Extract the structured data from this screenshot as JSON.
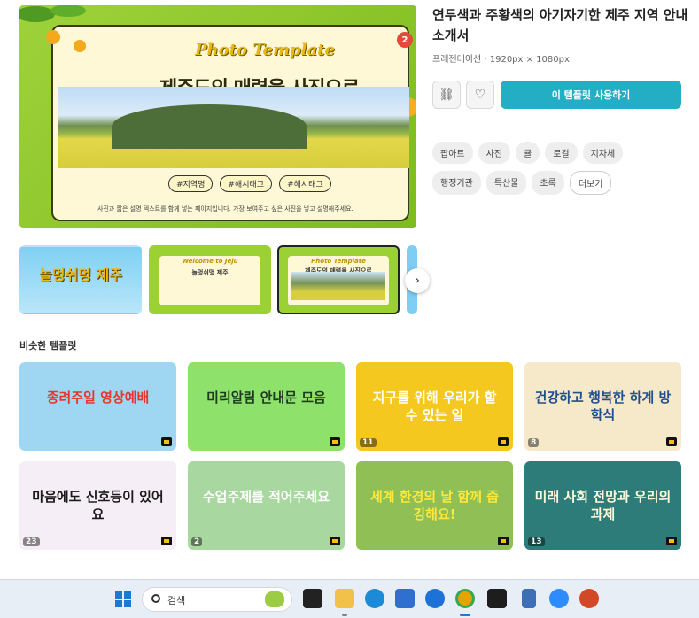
{
  "preview": {
    "script_title": "Photo Template",
    "title": "제주도의 매력을 사진으로",
    "badge": "2",
    "tags": [
      "#지역명",
      "#해시태그",
      "#해시태그"
    ],
    "caption": "사진과 짧은 설명 텍스트를 함께 넣는 페이지입니다. 가장 보여주고 싶은 사진을 넣고 설명해주세요."
  },
  "thumbnails": {
    "t1": "놀멍쉬멍 제주",
    "t2_script": "Welcome to Jeju",
    "t2_sub": "놀멍쉬멍 제주",
    "t3_script": "Photo Template",
    "t3_sub": "제주도의 매력을 사진으로",
    "next_icon": "›"
  },
  "info": {
    "title": "연두색과 주황색의 아기자기한 제주 지역 안내 소개서",
    "meta": "프레젠테이션 · 1920px × 1080px",
    "link_icon": "⛓",
    "like_icon": "♡",
    "use_button": "이 템플릿 사용하기",
    "tags": [
      "팝아트",
      "사진",
      "귤",
      "로컬",
      "지자체",
      "행정기관",
      "특산물",
      "초록"
    ],
    "more": "더보기"
  },
  "similar": {
    "label": "비슷한 템플릿",
    "cards": [
      {
        "text": "종려주일 영상예배",
        "num": "",
        "bg": "#9fd7f2",
        "color": "#e8352b"
      },
      {
        "text": "미리알림 안내문 모음",
        "num": "",
        "bg": "#8ee26b",
        "color": "#1e3a1e"
      },
      {
        "text": "지구를 위해 우리가 할 수 있는 일",
        "num": "11",
        "bg": "#f4c81f",
        "color": "#ffffff"
      },
      {
        "text": "건강하고 행복한 하계 방학식",
        "num": "8",
        "bg": "#f6e9c9",
        "color": "#1f4f8f"
      },
      {
        "text": "마음에도 신호등이 있어요",
        "num": "23",
        "bg": "#f6eef6",
        "color": "#1a1a1a"
      },
      {
        "text": "수업주제를 적어주세요",
        "num": "2",
        "bg": "#a9d7a0",
        "color": "#ffffff"
      },
      {
        "text": "세계 환경의 날 함께 줍깅해요!",
        "num": "",
        "bg": "#8fbf55",
        "color": "#ffe83a"
      },
      {
        "text": "미래 사회 전망과 우리의 과제",
        "num": "13",
        "bg": "#2d7c7a",
        "color": "#fff8d6"
      }
    ]
  },
  "taskbar": {
    "search_placeholder": "검색"
  }
}
